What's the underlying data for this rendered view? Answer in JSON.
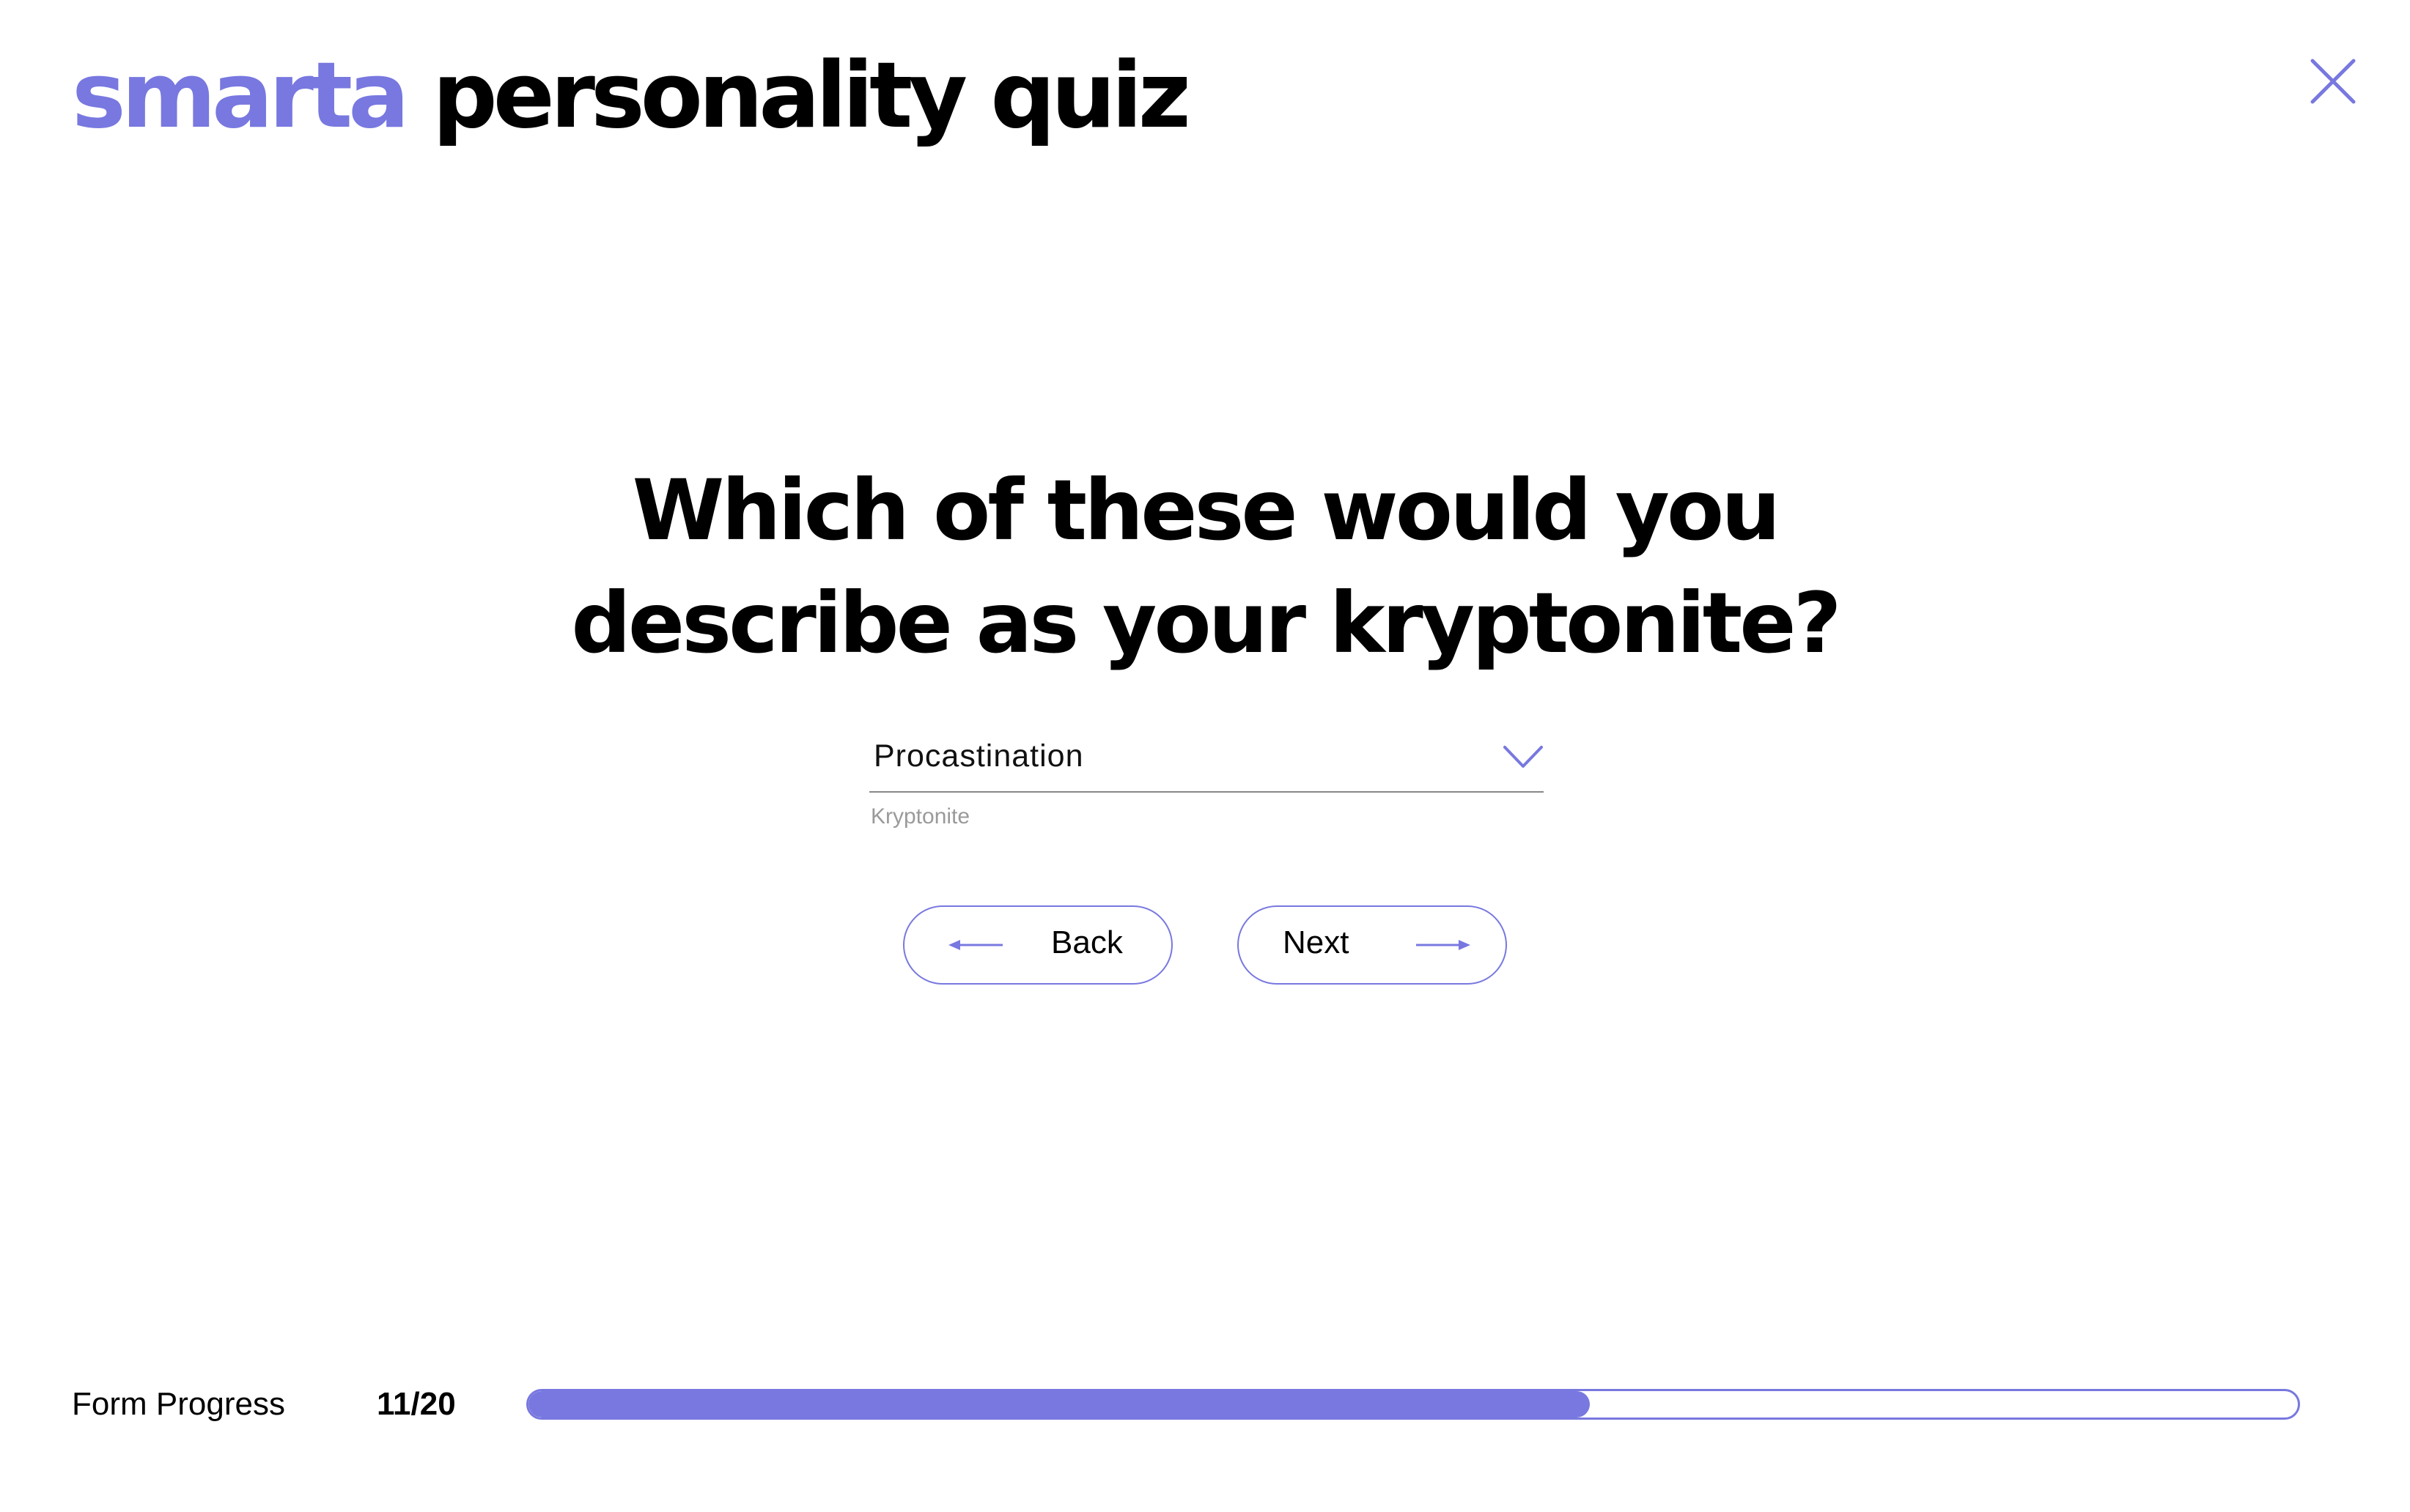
{
  "brand": {
    "accent": "smarta",
    "rest": "personality quiz"
  },
  "close_icon": "close-icon",
  "question": {
    "line1": "Which of these would you",
    "line2": "describe as your kryptonite?"
  },
  "answer_select": {
    "value": "Procastination",
    "helper": "Kryptonite",
    "icon": "chevron-down-icon"
  },
  "nav": {
    "back_label": "Back",
    "back_icon": "arrow-left-icon",
    "next_label": "Next",
    "next_icon": "arrow-right-icon"
  },
  "progress": {
    "label": "Form Progress",
    "count": "11/20",
    "current": 11,
    "total": 20,
    "fill_fraction": 0.6
  },
  "colors": {
    "accent": "#7878e0",
    "text": "#000000",
    "helper_text": "#9a9a9a",
    "underline": "#888888",
    "background": "#ffffff"
  }
}
